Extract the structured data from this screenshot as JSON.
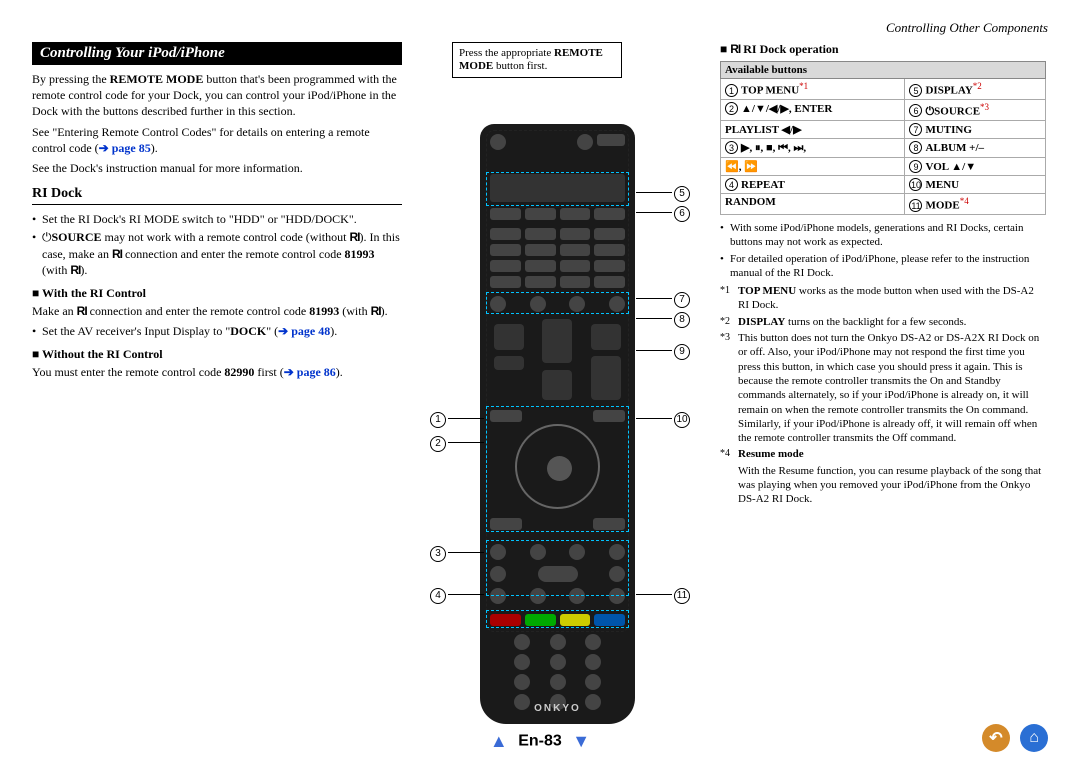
{
  "header": {
    "running_title": "Controlling Other Components"
  },
  "section": {
    "title": "Controlling Your iPod/iPhone"
  },
  "intro": {
    "p1a": "By pressing the ",
    "p1b": "REMOTE MODE",
    "p1c": " button that's been programmed with the remote control code for your Dock, you can control your iPod/iPhone in the Dock with the buttons described further in this section.",
    "p2a": "See \"Entering Remote Control Codes\" for details on entering a remote control code (",
    "p2link": "➔ page 85",
    "p2b": ").",
    "p3": "See the Dock's instruction manual for more information."
  },
  "ri_dock": {
    "heading": "RI Dock",
    "b1": "Set the RI Dock's RI MODE switch to \"HDD\" or \"HDD/DOCK\".",
    "b2a": "⏻",
    "b2b": "SOURCE",
    "b2c": " may not work with a remote control code (without ",
    "b2d": "). In this case, make an ",
    "b2e": " connection and enter the remote control code ",
    "b2code": "81993",
    "b2f": " (with ",
    "b2g": ").",
    "with_heading": "With the RI Control",
    "with_p_a": "Make an ",
    "with_p_b": " connection and enter the remote control code ",
    "with_code": "81993",
    "with_p_c": " (with ",
    "with_p_d": ").",
    "with_b3a": "Set the AV receiver's Input Display to \"",
    "with_b3b": "DOCK",
    "with_b3c": "\" (",
    "with_b3link": "➔ page 48",
    "with_b3d": ").",
    "without_heading": "Without the RI Control",
    "without_p_a": "You must enter the remote control code ",
    "without_code": "82990",
    "without_p_b": " first (",
    "without_link": "➔ page 86",
    "without_p_c": ")."
  },
  "remote_note": {
    "a": "Press the appropriate ",
    "b": "REMOTE MODE",
    "c": " button first."
  },
  "remote": {
    "brand": "ONKYO"
  },
  "callouts": {
    "1": "1",
    "2": "2",
    "3": "3",
    "4": "4",
    "5": "5",
    "6": "6",
    "7": "7",
    "8": "8",
    "9": "9",
    "10": "10",
    "11": "11"
  },
  "operation": {
    "heading": "RI Dock operation",
    "table_header": "Available buttons",
    "rows": [
      {
        "ln": "1",
        "l": "TOP MENU",
        "lsup": "*1",
        "rn": "5",
        "r": "DISPLAY",
        "rsup": "*2"
      },
      {
        "ln": "2",
        "l": "▲/▼/◀/▶, ENTER",
        "lsup": "",
        "rn": "6",
        "r": "⏻SOURCE",
        "rsup": "*3"
      },
      {
        "ln": "",
        "l": "PLAYLIST ◀/▶",
        "lsup": "",
        "rn": "7",
        "r": "MUTING",
        "rsup": ""
      },
      {
        "ln": "3",
        "l": "▶, ⏸, ■, ⏮, ⏭,",
        "lsup": "",
        "rn": "8",
        "r": "ALBUM +/–",
        "rsup": ""
      },
      {
        "ln": "",
        "l": "⏪, ⏩",
        "lsup": "",
        "rn": "9",
        "r": "VOL ▲/▼",
        "rsup": ""
      },
      {
        "ln": "4",
        "l": "REPEAT",
        "lsup": "",
        "rn": "10",
        "r": "MENU",
        "rsup": ""
      },
      {
        "ln": "",
        "l": "RANDOM",
        "lsup": "",
        "rn": "11",
        "r": "MODE",
        "rsup": "*4"
      }
    ],
    "notes": [
      "With some iPod/iPhone models, generations and RI Docks, certain buttons may not work as expected.",
      "For detailed operation of iPod/iPhone, please refer to the instruction manual of the RI Dock."
    ],
    "footnotes": [
      {
        "lab": "*1",
        "txt_a": "TOP MENU",
        "txt_b": " works as the mode button when used with the DS-A2 RI Dock."
      },
      {
        "lab": "*2",
        "txt_a": "DISPLAY",
        "txt_b": " turns on the backlight for a few seconds."
      },
      {
        "lab": "*3",
        "txt_a": "",
        "txt_b": "This button does not turn the Onkyo DS-A2 or DS-A2X RI Dock on or off. Also, your iPod/iPhone may not respond the first time you press this button, in which case you should press it again. This is because the remote controller transmits the On and Standby commands alternately, so if your iPod/iPhone is already on, it will remain on when the remote controller transmits the On command. Similarly, if your iPod/iPhone is already off, it will remain off when the remote controller transmits the Off command."
      },
      {
        "lab": "*4",
        "txt_a": "Resume mode",
        "txt_b": ""
      }
    ],
    "resume_text": "With the Resume function, you can resume playback of the song that was playing when you removed your iPod/iPhone from the Onkyo DS-A2 RI Dock."
  },
  "footer": {
    "page": "En-83"
  },
  "icons": {
    "back": "↶",
    "home": "⌂"
  }
}
